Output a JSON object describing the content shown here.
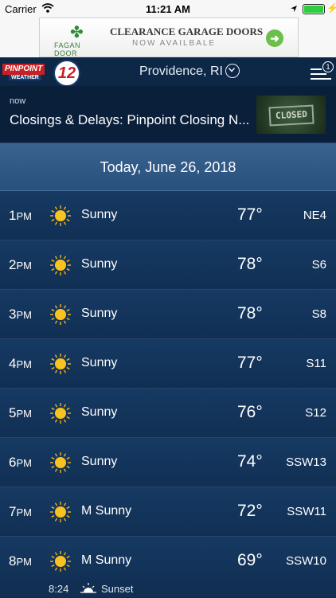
{
  "status_bar": {
    "carrier": "Carrier",
    "time": "11:21 AM"
  },
  "ad": {
    "brand": "FAGAN DOOR",
    "line1": "CLEARANCE GARAGE DOORS",
    "line2": "NOW AVAILBALE"
  },
  "header": {
    "logo_text": "PINPOINT",
    "logo_sub": "WEATHER",
    "logo_number": "12",
    "location": "Providence, RI",
    "menu_badge": "1"
  },
  "alert": {
    "time": "now",
    "message": "Closings & Delays: Pinpoint Closing N...",
    "thumb_text": "CLOSED"
  },
  "date_header": "Today, June 26, 2018",
  "hours": [
    {
      "hour": "1",
      "ampm": "PM",
      "condition": "Sunny",
      "temp": "77°",
      "wind": "NE4"
    },
    {
      "hour": "2",
      "ampm": "PM",
      "condition": "Sunny",
      "temp": "78°",
      "wind": "S6"
    },
    {
      "hour": "3",
      "ampm": "PM",
      "condition": "Sunny",
      "temp": "78°",
      "wind": "S8"
    },
    {
      "hour": "4",
      "ampm": "PM",
      "condition": "Sunny",
      "temp": "77°",
      "wind": "S11"
    },
    {
      "hour": "5",
      "ampm": "PM",
      "condition": "Sunny",
      "temp": "76°",
      "wind": "S12"
    },
    {
      "hour": "6",
      "ampm": "PM",
      "condition": "Sunny",
      "temp": "74°",
      "wind": "SSW13"
    },
    {
      "hour": "7",
      "ampm": "PM",
      "condition": "M Sunny",
      "temp": "72°",
      "wind": "SSW11"
    },
    {
      "hour": "8",
      "ampm": "PM",
      "condition": "M Sunny",
      "temp": "69°",
      "wind": "SSW10"
    }
  ],
  "sunset": {
    "time": "8:24",
    "label": "Sunset"
  },
  "icons": {
    "weather": "sun-icon",
    "sunset": "sunset-icon",
    "location": "location-arrow-icon"
  },
  "colors": {
    "background": "#0c2a4f",
    "row": "#163a63",
    "date_bar": "#3a6390",
    "ad_button": "#6cbf4a",
    "logo_red": "#c61f24"
  }
}
